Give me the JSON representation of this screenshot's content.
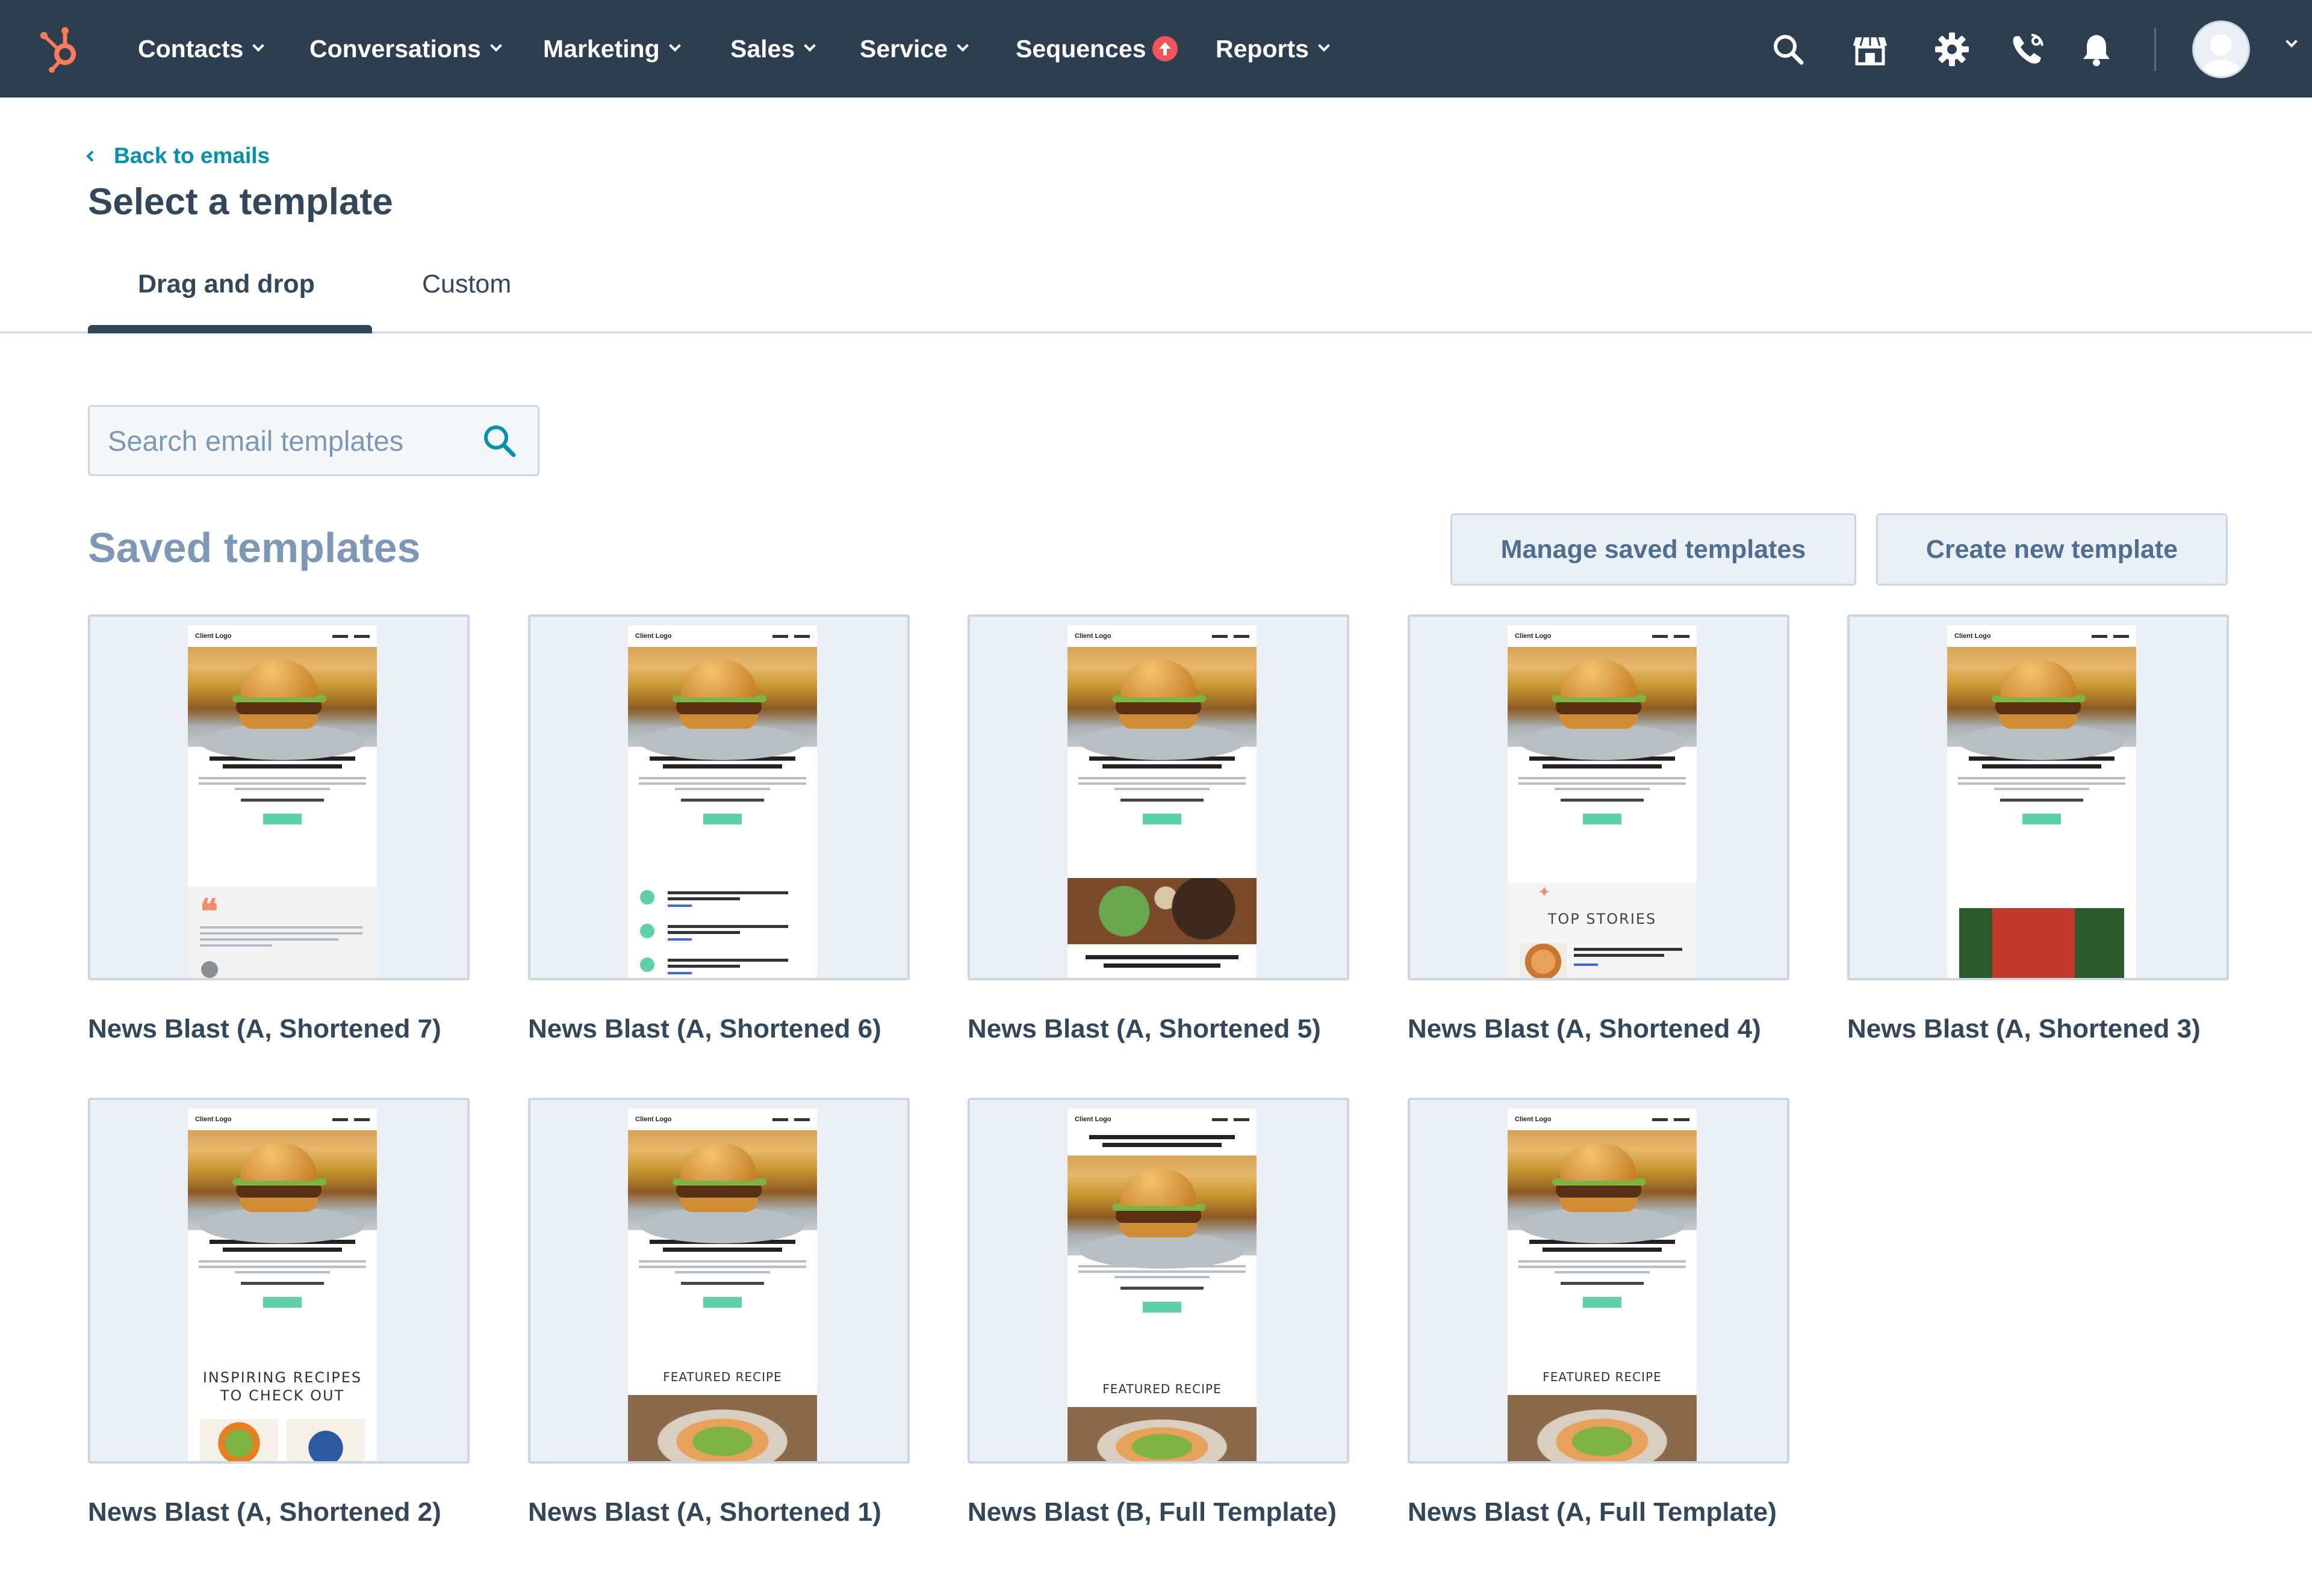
{
  "nav": {
    "items": [
      {
        "label": "Contacts"
      },
      {
        "label": "Conversations"
      },
      {
        "label": "Marketing"
      },
      {
        "label": "Sales"
      },
      {
        "label": "Service"
      },
      {
        "label": "Sequences"
      },
      {
        "label": "Reports"
      }
    ],
    "icons": [
      "search-icon",
      "marketplace-icon",
      "settings-icon",
      "calling-icon",
      "notifications-icon"
    ],
    "colors": {
      "background": "#2d3e50",
      "logo": "#ff7a59",
      "badge": "#f2545b"
    }
  },
  "header": {
    "back_label": "Back to emails",
    "title": "Select a template"
  },
  "tabs": [
    {
      "label": "Drag and drop",
      "active": true
    },
    {
      "label": "Custom",
      "active": false
    }
  ],
  "search": {
    "placeholder": "Search email templates",
    "value": ""
  },
  "section": {
    "title": "Saved templates",
    "manage_label": "Manage saved templates",
    "create_label": "Create new template"
  },
  "preview_text": {
    "client_logo": "Client Logo",
    "top_stories": "TOP STORIES",
    "featured_recipe": "FEATURED RECIPE",
    "inspiring_line1": "INSPIRING RECIPES",
    "inspiring_line2": "TO CHECK OUT"
  },
  "templates": [
    {
      "name": "News Blast (A, Shortened 7)"
    },
    {
      "name": "News Blast (A, Shortened 6)"
    },
    {
      "name": "News Blast (A, Shortened 5)"
    },
    {
      "name": "News Blast (A, Shortened 4)"
    },
    {
      "name": "News Blast (A, Shortened 3)"
    },
    {
      "name": "News Blast (A, Shortened 2)"
    },
    {
      "name": "News Blast (A, Shortened 1)"
    },
    {
      "name": "News Blast (B, Full Template)"
    },
    {
      "name": "News Blast (A, Full Template)"
    }
  ]
}
